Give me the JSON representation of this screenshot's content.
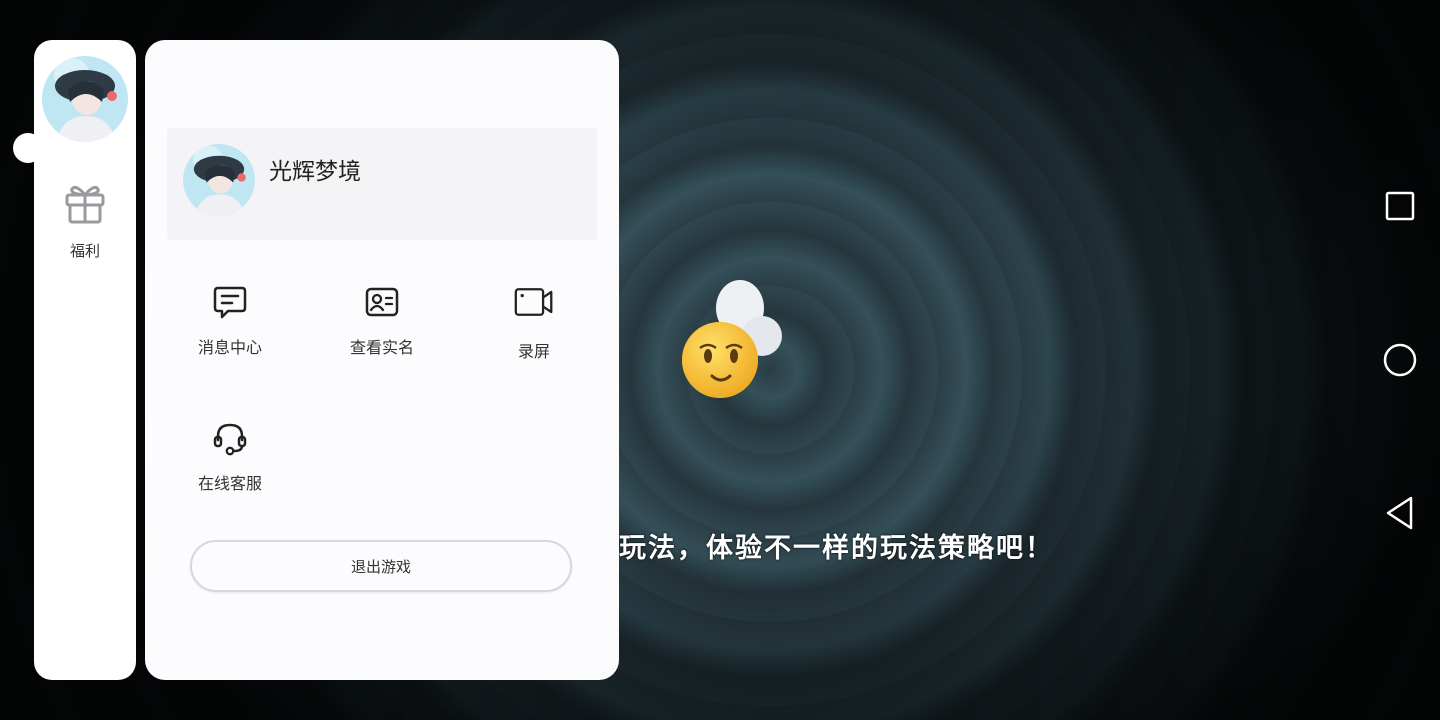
{
  "game": {
    "subtitle": "的玩法，体验不一样的玩法策略吧！",
    "mascot_icon": "smiley-mascot-icon"
  },
  "rail": {
    "avatar_icon": "avatar-icon",
    "gift_icon": "gift-icon",
    "gift_label": "福利"
  },
  "profile": {
    "name": "光辉梦境",
    "avatar_icon": "avatar-icon"
  },
  "menu": {
    "items": [
      {
        "label": "消息中心",
        "icon": "message-icon"
      },
      {
        "label": "查看实名",
        "icon": "id-card-icon"
      },
      {
        "label": "录屏",
        "icon": "video-camera-icon"
      },
      {
        "label": "在线客服",
        "icon": "headset-icon"
      }
    ],
    "exit_label": "退出游戏"
  },
  "nav": {
    "icons": [
      "square-recents-icon",
      "circle-home-icon",
      "triangle-back-icon"
    ]
  },
  "colors": {
    "panel_bg": "#fcfbfe",
    "card_bg": "#f4f3f6",
    "text": "#333333",
    "icon": "#222222"
  }
}
